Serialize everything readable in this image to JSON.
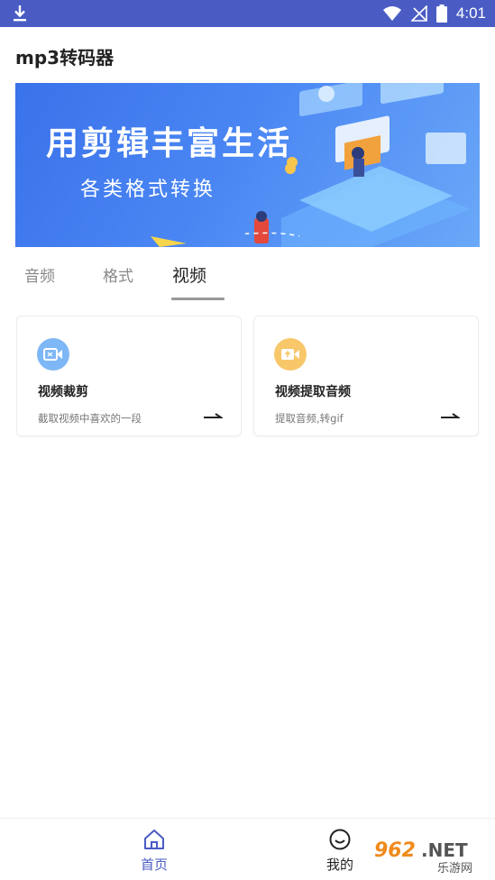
{
  "status_bar": {
    "time": "4:01",
    "icons": [
      "download-icon",
      "wifi-icon",
      "no-signal-icon",
      "battery-icon"
    ],
    "color": "#4a5cc4"
  },
  "app": {
    "title": "mp3转码器"
  },
  "banner": {
    "title": "用剪辑丰富生活",
    "subtitle": "各类格式转换"
  },
  "tabs": [
    {
      "label": "音频",
      "active": false
    },
    {
      "label": "格式",
      "active": false
    },
    {
      "label": "视频",
      "active": true
    }
  ],
  "cards": [
    {
      "icon": "video-crop-icon",
      "icon_color": "#7eb7f5",
      "title": "视频裁剪",
      "description": "截取视频中喜欢的一段"
    },
    {
      "icon": "video-extract-audio-icon",
      "icon_color": "#f7c76a",
      "title": "视频提取音频",
      "description": "提取音频,转gif"
    }
  ],
  "bottom_nav": [
    {
      "label": "首页",
      "icon": "home-icon",
      "active": true
    },
    {
      "label": "我的",
      "icon": "smile-icon",
      "active": false
    }
  ],
  "watermark": {
    "text": "962.NET",
    "subtext": "乐游网"
  }
}
